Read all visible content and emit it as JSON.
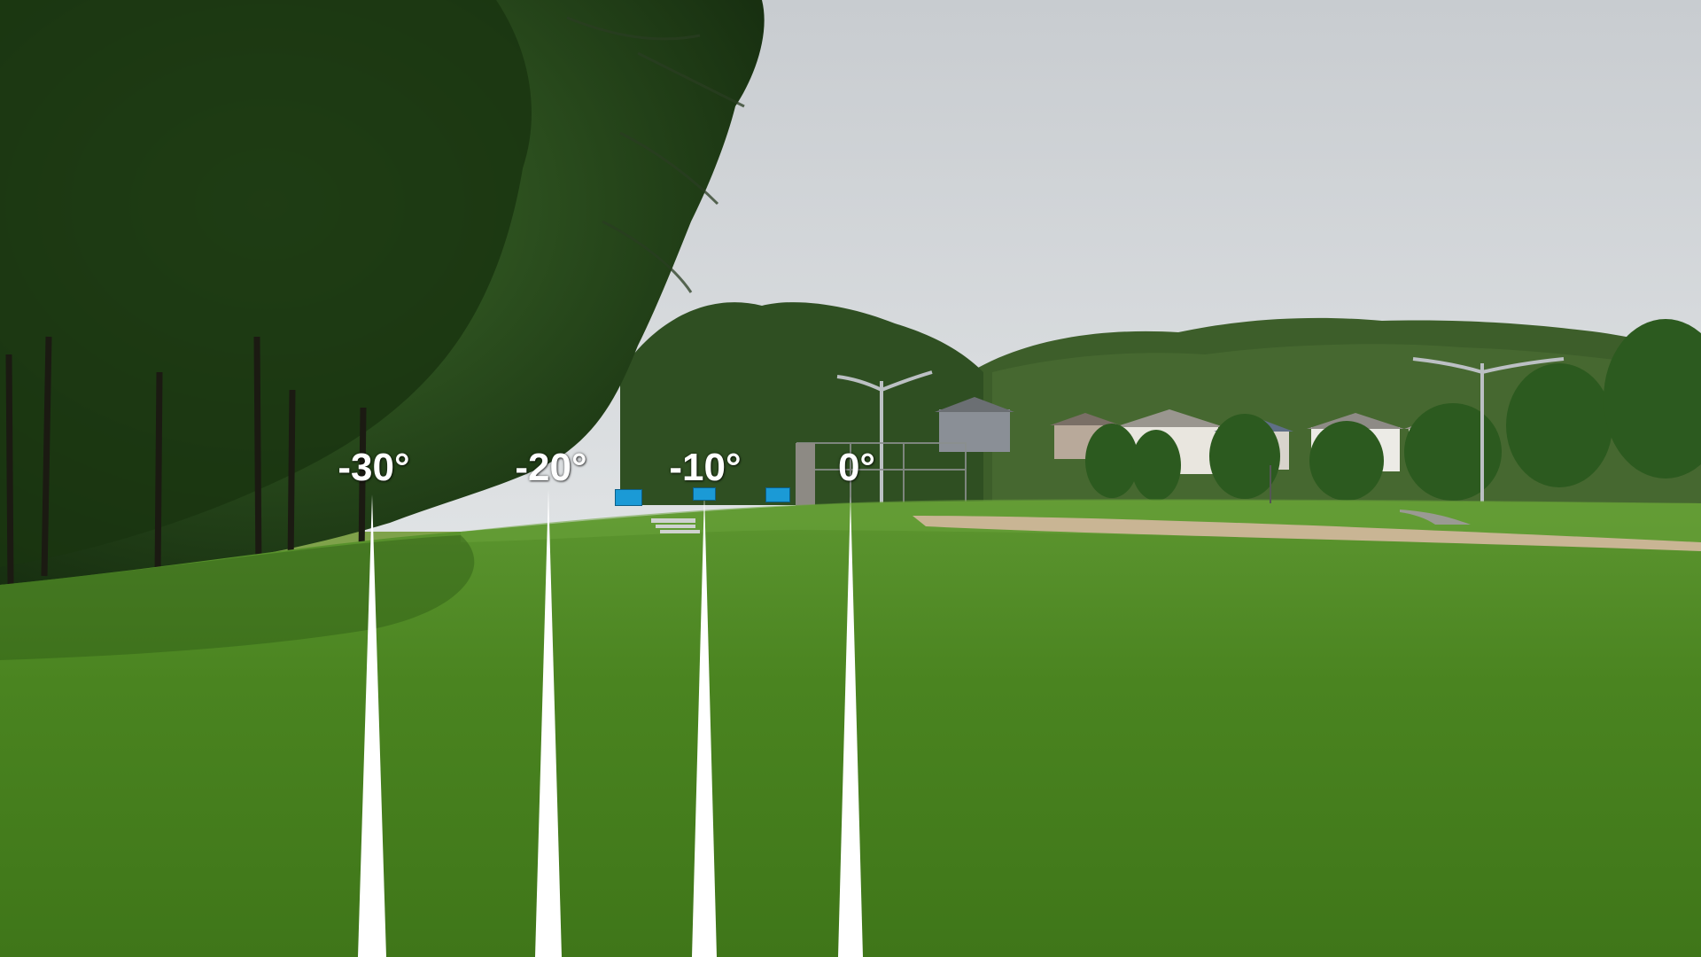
{
  "colors": {
    "sky": "#d4d8dc",
    "grass": "#4f8a1f",
    "trees": "#1f3a16",
    "infield_dirt": "#c9b594",
    "pointer": "#ffffff",
    "flag": "#1b9ad6"
  },
  "angle_markers": [
    {
      "label": "-30°",
      "angle": -30
    },
    {
      "label": "-20°",
      "angle": -20
    },
    {
      "label": "-10°",
      "angle": -10
    },
    {
      "label": "0°",
      "angle": 0
    }
  ],
  "flags": [
    {
      "name": "flag-left",
      "color": "#1b9ad6"
    },
    {
      "name": "flag-center",
      "color": "#1b9ad6"
    },
    {
      "name": "flag-right",
      "color": "#1b9ad6"
    }
  ]
}
